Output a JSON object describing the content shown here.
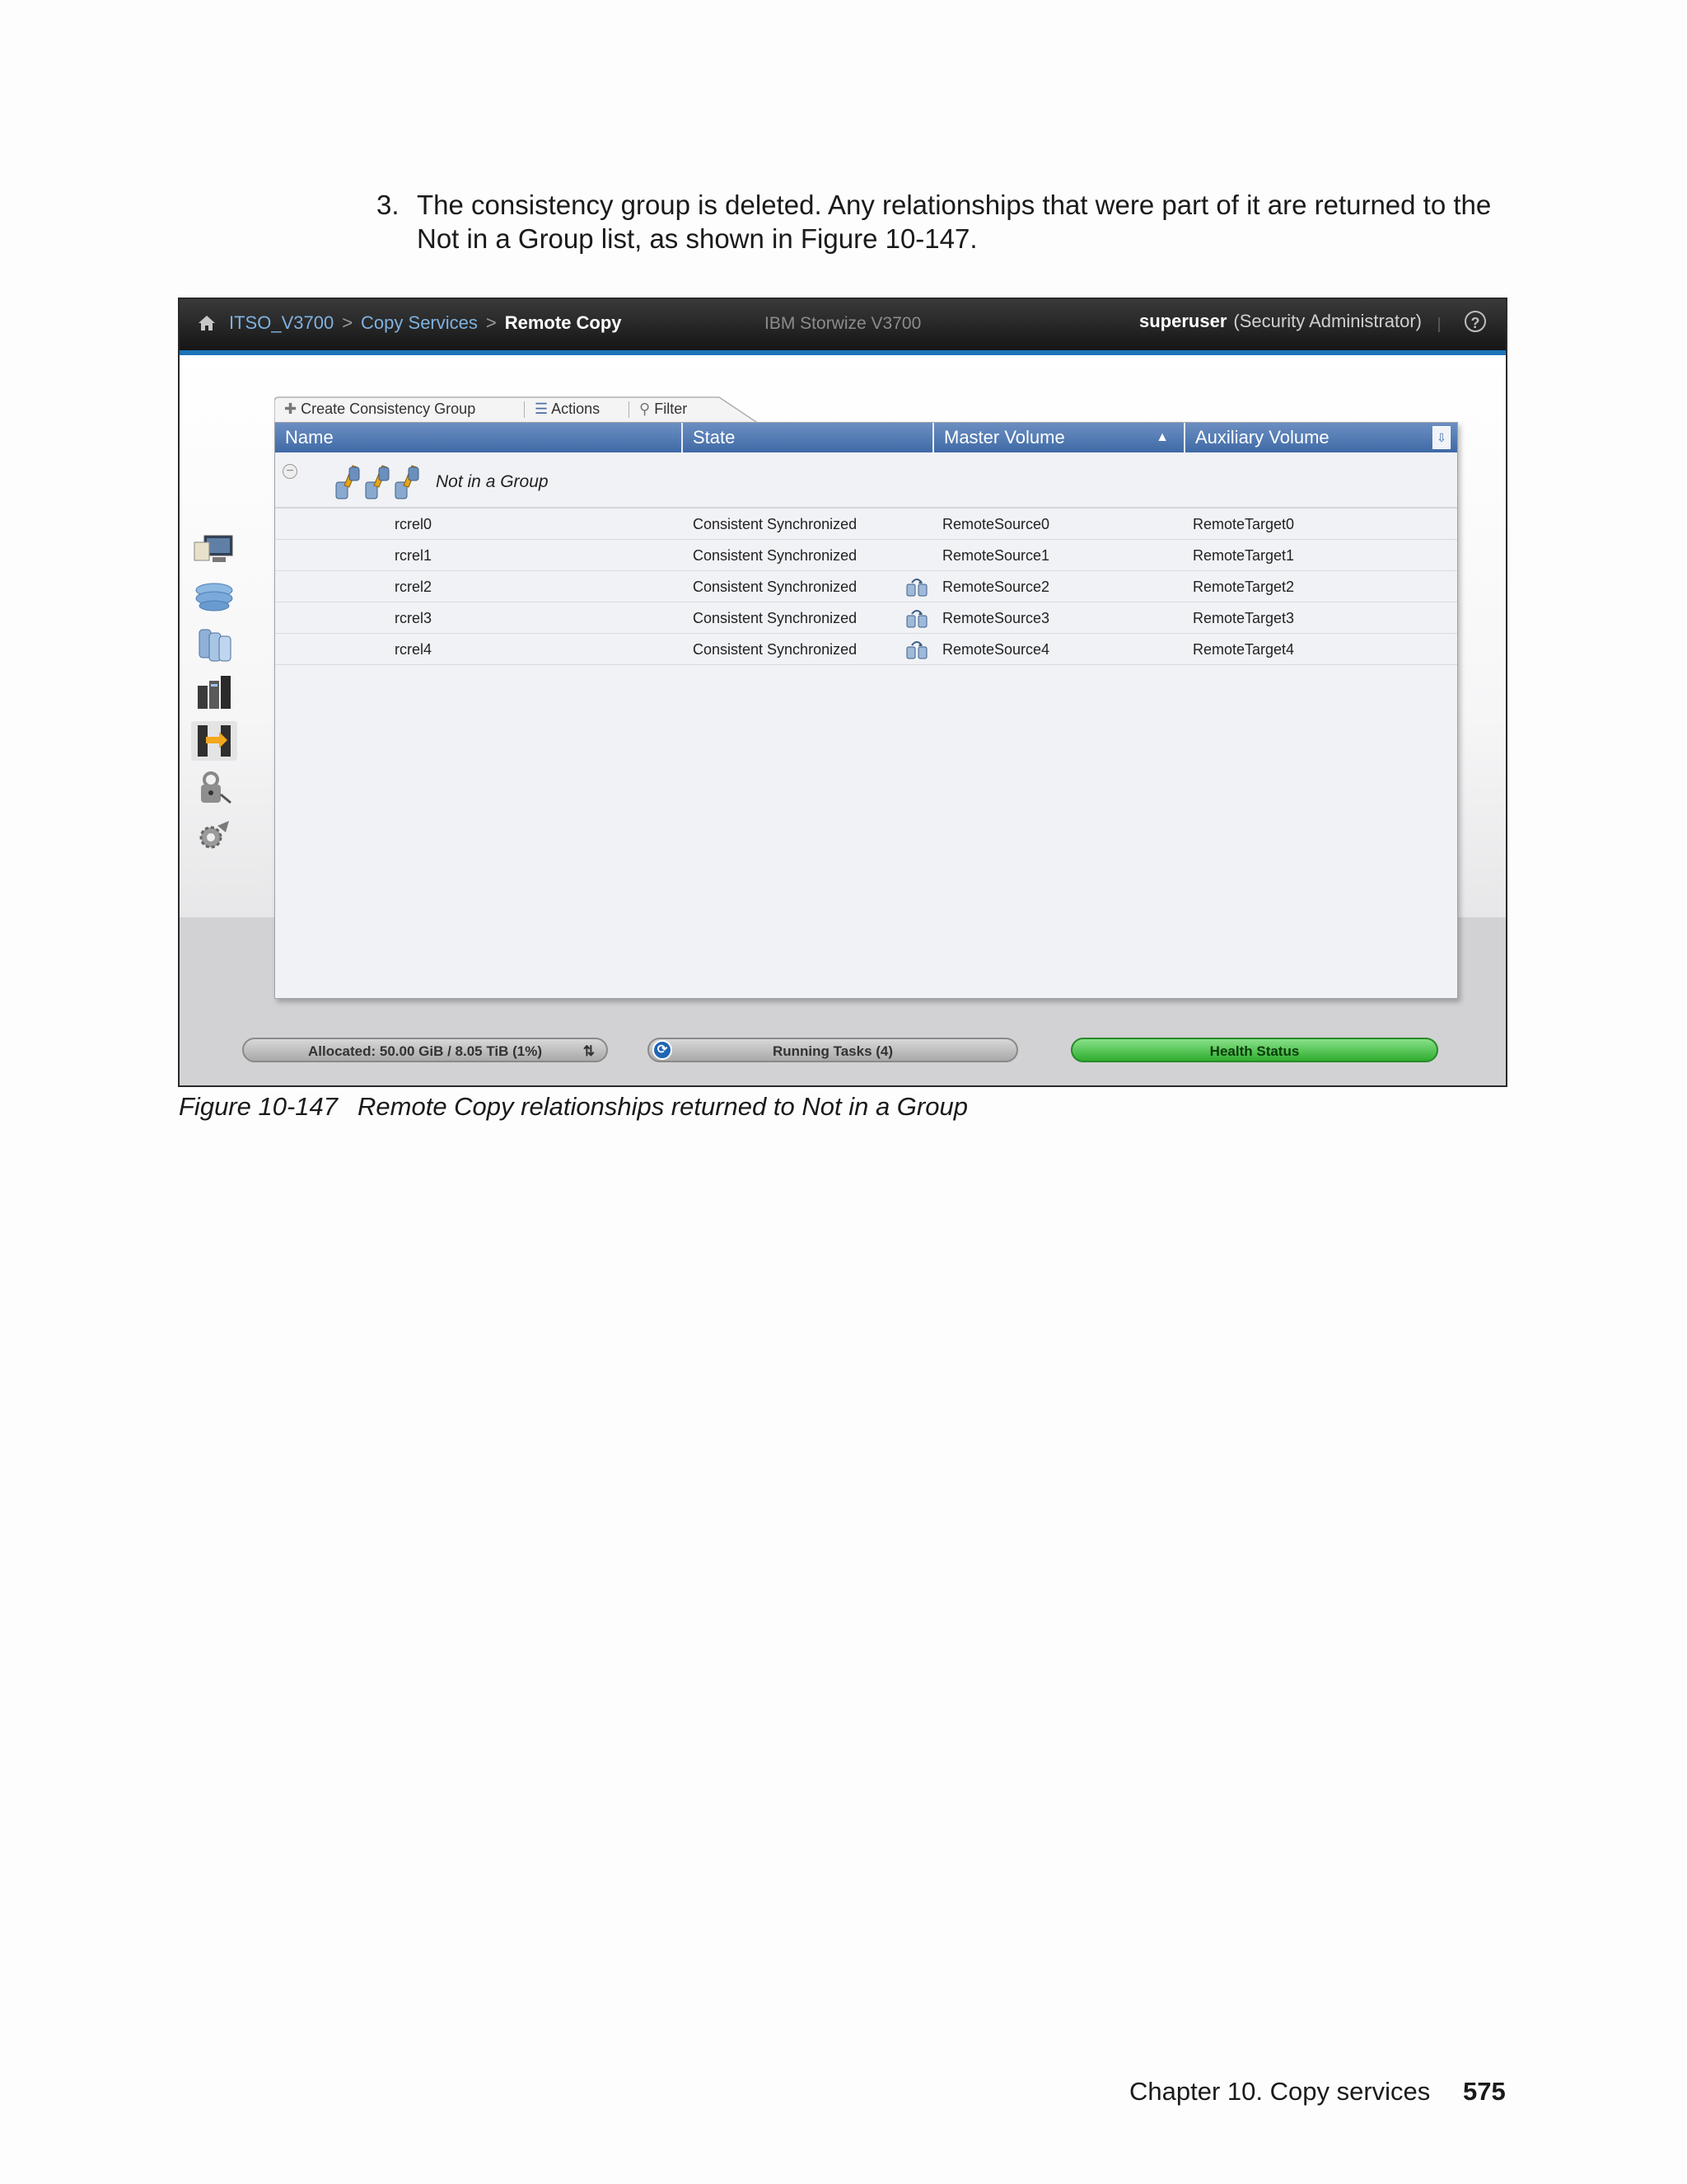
{
  "intro": {
    "number": "3.",
    "text": "The consistency group is deleted. Any relationships that were part of it are returned to the Not in a Group list, as shown in Figure 10-147."
  },
  "app": {
    "breadcrumb": [
      "ITSO_V3700",
      "Copy Services",
      "Remote Copy"
    ],
    "breadcrumb_separator": ">",
    "product": "IBM Storwize V3700",
    "user": "superuser",
    "role": "(Security Administrator)",
    "help_label": "?",
    "accent_color": "#1c74b8",
    "sidebar_icons": [
      "monitoring-icon",
      "pools-icon",
      "volumes-icon",
      "hosts-icon",
      "copy-services-icon",
      "access-icon",
      "settings-icon"
    ],
    "toolbar": {
      "create": "Create Consistency Group",
      "actions": "Actions",
      "filter": "Filter"
    },
    "columns": {
      "name": "Name",
      "state": "State",
      "master": "Master Volume",
      "auxiliary": "Auxiliary Volume"
    },
    "group_label": "Not in a Group",
    "rows": [
      {
        "name": "rcrel0",
        "state": "Consistent Synchronized",
        "master": "RemoteSource0",
        "aux": "RemoteTarget0",
        "has_icon": false
      },
      {
        "name": "rcrel1",
        "state": "Consistent Synchronized",
        "master": "RemoteSource1",
        "aux": "RemoteTarget1",
        "has_icon": false
      },
      {
        "name": "rcrel2",
        "state": "Consistent Synchronized",
        "master": "RemoteSource2",
        "aux": "RemoteTarget2",
        "has_icon": true
      },
      {
        "name": "rcrel3",
        "state": "Consistent Synchronized",
        "master": "RemoteSource3",
        "aux": "RemoteTarget3",
        "has_icon": true
      },
      {
        "name": "rcrel4",
        "state": "Consistent Synchronized",
        "master": "RemoteSource4",
        "aux": "RemoteTarget4",
        "has_icon": true
      }
    ],
    "status": {
      "allocated": "Allocated: 50.00 GiB / 8.05 TiB (1%)",
      "running_tasks": "Running Tasks (4)",
      "health": "Health Status",
      "health_color": "#2fae2f"
    }
  },
  "caption": {
    "label": "Figure 10-147",
    "text": "Remote Copy relationships returned to Not in a Group"
  },
  "footer": {
    "chapter": "Chapter 10. Copy services",
    "page": "575"
  }
}
